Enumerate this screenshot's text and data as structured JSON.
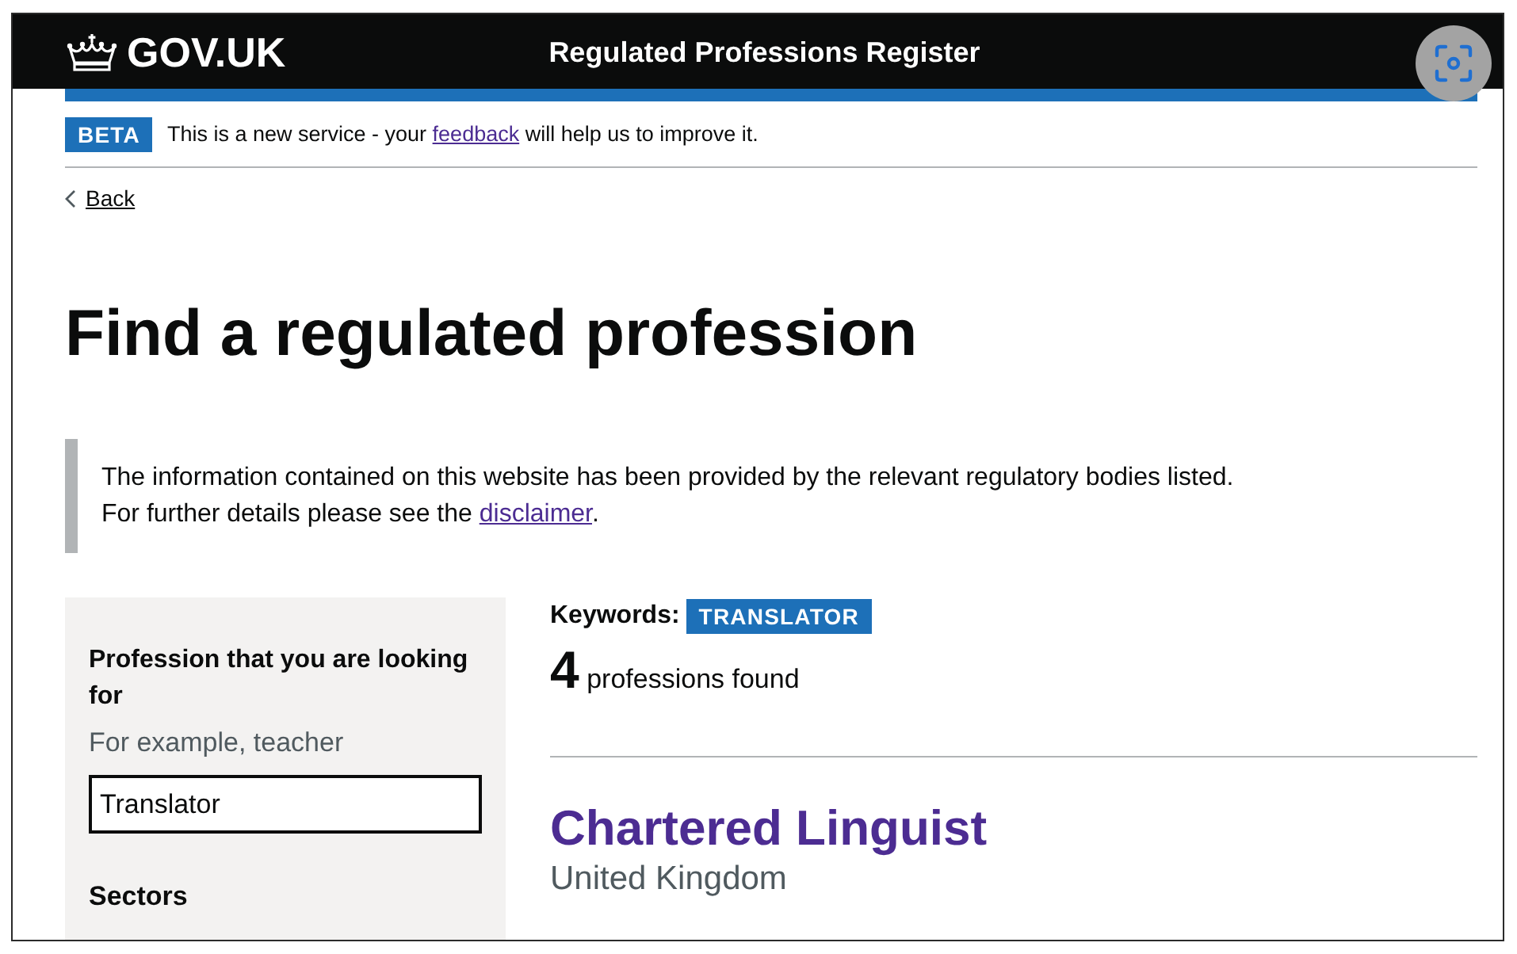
{
  "header": {
    "logo_text": "GOV.UK",
    "service_name": "Regulated Professions Register"
  },
  "phase_banner": {
    "tag": "BETA",
    "text_before": "This is a new service - your ",
    "link": "feedback",
    "text_after": " will help us to improve it."
  },
  "back_link": "Back",
  "title": "Find a regulated profession",
  "inset": {
    "line_1": "The information contained on this website has been provided by the relevant regulatory bodies listed.",
    "line_2_before": "For further details please see the ",
    "link": "disclaimer",
    "line_2_after": "."
  },
  "filters": {
    "profession": {
      "label": "Profession that you are looking for",
      "hint": "For example, teacher",
      "value": "Translator"
    },
    "sectors_heading": "Sectors"
  },
  "results": {
    "keywords_label": "Keywords:",
    "keywords": [
      "TRANSLATOR"
    ],
    "count": "4",
    "count_label": "professions found",
    "items": [
      {
        "name": "Chartered Linguist",
        "location": "United Kingdom"
      }
    ]
  }
}
